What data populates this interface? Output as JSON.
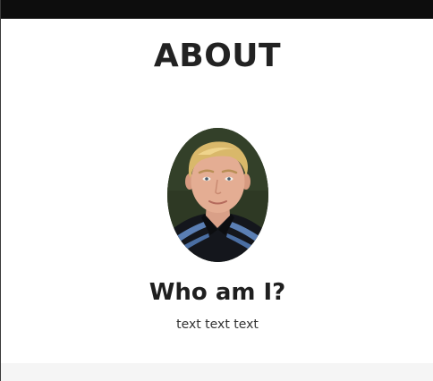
{
  "about": {
    "title": "ABOUT",
    "heading": "Who am I?",
    "text": "text text text"
  },
  "colors": {
    "top_bar": "#0d0d0d",
    "footer": "#f5f5f5",
    "text": "#222222"
  }
}
